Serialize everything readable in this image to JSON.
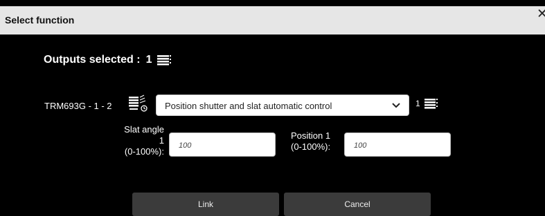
{
  "dialog": {
    "title": "Select function",
    "close_icon": "close-x"
  },
  "outputs": {
    "label": "Outputs selected :",
    "count": "1",
    "icon": "shutter-stack-icon"
  },
  "row": {
    "device_label": "TRM693G - 1 - 2",
    "device_icon": "shutter-motor-icon",
    "function_value": "Position shutter and slat automatic control",
    "after_count": "1",
    "after_icon": "shutter-stack-icon"
  },
  "fields": {
    "slat_label_1": "Slat angle",
    "slat_label_2": "1",
    "slat_label_3": "(0-100%):",
    "slat_value": "100",
    "position_label_1": "Position 1",
    "position_label_2": "(0-100%):",
    "position_value": "100"
  },
  "buttons": {
    "link_label": "Link",
    "cancel_label": "Cancel"
  }
}
